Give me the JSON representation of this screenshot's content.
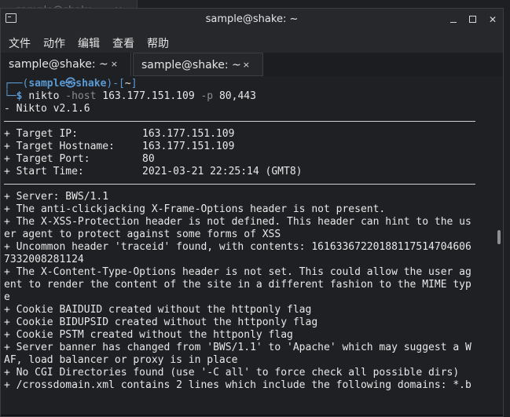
{
  "background_window": {
    "title": "sample@shake: ~",
    "close": "×"
  },
  "window": {
    "title": "sample@shake: ~",
    "buttons": {
      "minimize": "",
      "maximize": "",
      "close": "✕"
    }
  },
  "menu": {
    "items": [
      {
        "label": "文件"
      },
      {
        "label": "动作"
      },
      {
        "label": "编辑"
      },
      {
        "label": "查看"
      },
      {
        "label": "帮助"
      }
    ]
  },
  "tabs": [
    {
      "label": "sample@shake: ~",
      "close": "×",
      "active": true
    },
    {
      "label": "sample@shake: ~",
      "close": "×",
      "active": false
    }
  ],
  "terminal": {
    "prompt": {
      "frame_top": "┌──(",
      "user": "sample㉿shake",
      "mid": ")-[",
      "dir": "~",
      "end": "]",
      "frame_bottom": "└─",
      "symbol": "$"
    },
    "command": {
      "name": "nikto",
      "flag_host": "-host",
      "host": "163.177.151.109",
      "flag_port": "-p",
      "ports": "80,443"
    },
    "version": "- Nikto v2.1.6",
    "targets": [
      {
        "label": "+ Target IP:",
        "value": "163.177.151.109"
      },
      {
        "label": "+ Target Hostname:",
        "value": "163.177.151.109"
      },
      {
        "label": "+ Target Port:",
        "value": "80"
      },
      {
        "label": "+ Start Time:",
        "value": "2021-03-21 22:25:14 (GMT8)"
      }
    ],
    "results": [
      "+ Server: BWS/1.1",
      "+ The anti-clickjacking X-Frame-Options header is not present.",
      "+ The X-XSS-Protection header is not defined. This header can hint to the us",
      "er agent to protect against some forms of XSS",
      "+ Uncommon header 'traceid' found, with contents: 16163367220188117514704606",
      "7332008281124",
      "+ The X-Content-Type-Options header is not set. This could allow the user ag",
      "ent to render the content of the site in a different fashion to the MIME typ",
      "e",
      "+ Cookie BAIDUID created without the httponly flag",
      "+ Cookie BIDUPSID created without the httponly flag",
      "+ Cookie PSTM created without the httponly flag",
      "+ Server banner has changed from 'BWS/1.1' to 'Apache' which may suggest a W",
      "AF, load balancer or proxy is in place",
      "+ No CGI Directories found (use '-C all' to force check all possible dirs)",
      "+ /crossdomain.xml contains 2 lines which include the following domains: *.b"
    ]
  }
}
